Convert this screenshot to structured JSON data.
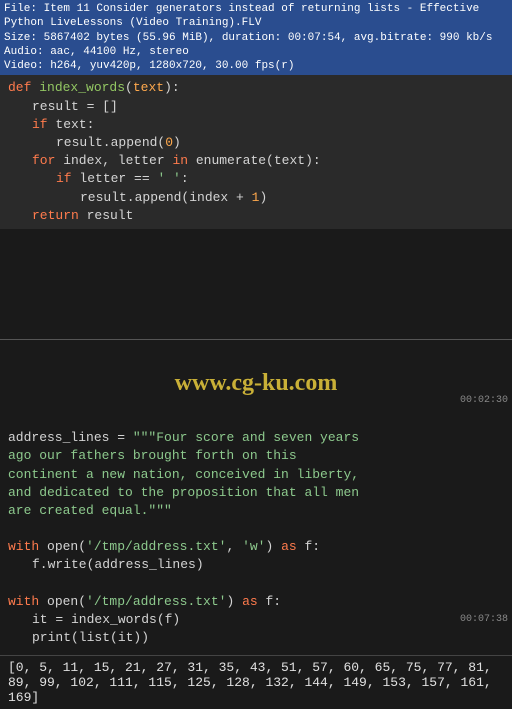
{
  "header": {
    "line1": "File: Item 11 Consider generators instead of returning lists - Effective Python LiveLessons (Video Training).FLV",
    "line2": "Size: 5867402 bytes (55.96 MiB), duration: 00:07:54, avg.bitrate: 990 kb/s",
    "line3": "Audio: aac, 44100 Hz, stereo",
    "line4": "Video: h264, yuv420p, 1280x720, 30.00 fps(r)"
  },
  "code1": {
    "l1_def": "def",
    "l1_fn": "index_words",
    "l1_paren": "(",
    "l1_param": "text",
    "l1_close": "):",
    "l2_var": "result",
    "l2_eq": " = ",
    "l2_val": "[]",
    "l3_if": "if",
    "l3_cond": " text:",
    "l4_call": "result.append(",
    "l4_num": "0",
    "l4_close": ")",
    "l5_for": "for",
    "l5_vars": " index, letter ",
    "l5_in": "in",
    "l5_enum": " enumerate(text):",
    "l6_if": "if",
    "l6_cond": " letter == ",
    "l6_str": "' '",
    "l6_colon": ":",
    "l7_call": "result.append(index + ",
    "l7_num": "1",
    "l7_close": ")",
    "l8_ret": "return",
    "l8_var": " result"
  },
  "watermark": "www.cg-ku.com",
  "timestamps": {
    "t1": "00:02:30",
    "t2": "00:07:38"
  },
  "code2": {
    "dim_line": "",
    "l1_var": "address_lines",
    "l1_eq": " = ",
    "l1_str1": "\"\"\"Four score and seven years",
    "l2_str": "ago our fathers brought forth on this",
    "l3_str": "continent a new nation, conceived in liberty,",
    "l4_str": "and dedicated to the proposition that all men",
    "l5_str": "are created equal.\"\"\"",
    "l6_with": "with",
    "l6_open": " open(",
    "l6_path": "'/tmp/address.txt'",
    "l6_comma": ", ",
    "l6_mode": "'w'",
    "l6_close": ") ",
    "l6_as": "as",
    "l6_f": " f:",
    "l7_call": "f.write(address_lines)",
    "l8_with": "with",
    "l8_open": " open(",
    "l8_path": "'/tmp/address.txt'",
    "l8_close": ") ",
    "l8_as": "as",
    "l8_f": " f:",
    "l9_call": "it = index_words(f)",
    "l10_call": "print(list(it))"
  },
  "output": "[0, 5, 11, 15, 21, 27, 31, 35, 43, 51, 57, 60, 65, 75, 77, 81, 89, 99, 102, 111, 115, 125, 128, 132, 144, 149, 153, 157, 161, 169]"
}
